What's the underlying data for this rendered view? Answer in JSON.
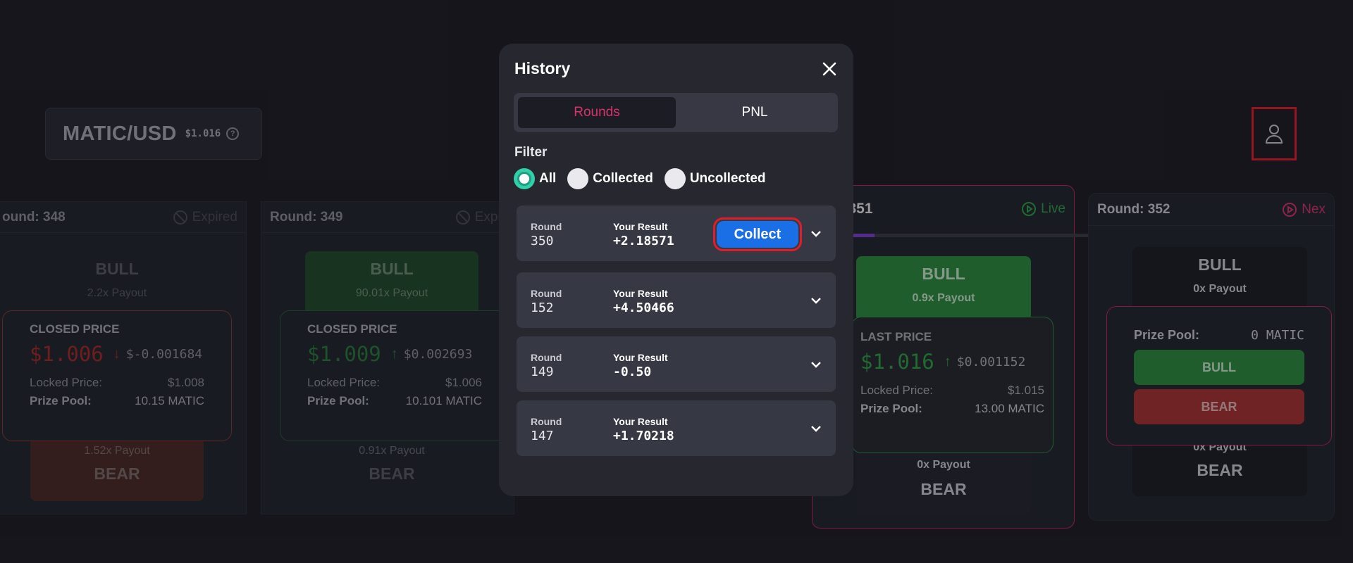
{
  "market": {
    "pair": "MATIC/USD",
    "price": "$1.016",
    "help_icon": "question-circle-icon"
  },
  "user_icon": "user-icon",
  "rounds": [
    {
      "round_label": "ound: 348",
      "status": "Expired",
      "bull": {
        "label": "BULL",
        "payout": "2.2x Payout"
      },
      "panel": {
        "title": "CLOSED PRICE",
        "price": "$1.006",
        "delta": "$-0.001684",
        "locked_label": "Locked Price:",
        "locked_value": "$1.008",
        "pool_label": "Prize Pool:",
        "pool_value": "10.15 MATIC"
      },
      "bear": {
        "label": "BEAR",
        "payout": "1.52x Payout"
      }
    },
    {
      "round_label": "Round: 349",
      "status": "Expir",
      "bull": {
        "label": "BULL",
        "payout": "90.01x Payout"
      },
      "panel": {
        "title": "CLOSED PRICE",
        "price": "$1.009",
        "delta": "$0.002693",
        "locked_label": "Locked Price:",
        "locked_value": "$1.006",
        "pool_label": "Prize Pool:",
        "pool_value": "10.101 MATIC"
      },
      "bear": {
        "label": "BEAR",
        "payout": "0.91x Payout"
      }
    },
    {
      "round_label": "nd: 351",
      "status": "Live",
      "bull": {
        "label": "BULL",
        "payout": "0.9x Payout"
      },
      "panel": {
        "title": "LAST PRICE",
        "price": "$1.016",
        "delta": "$0.001152",
        "locked_label": "Locked Price:",
        "locked_value": "$1.015",
        "pool_label": "Prize Pool:",
        "pool_value": "13.00 MATIC"
      },
      "bear": {
        "label": "BEAR",
        "payout": "0x Payout"
      }
    },
    {
      "round_label": "Round: 352",
      "status": "Nex",
      "bull": {
        "label": "BULL",
        "payout": "0x Payout"
      },
      "panel": {
        "pool_label": "Prize Pool:",
        "pool_value": "0 MATIC",
        "bull_btn": "BULL",
        "bear_btn": "BEAR"
      },
      "bear": {
        "label": "BEAR",
        "payout": "0x Payout"
      }
    }
  ],
  "modal": {
    "title": "History",
    "close_icon": "close-icon",
    "tabs": [
      {
        "label": "Rounds",
        "active": true
      },
      {
        "label": "PNL",
        "active": false
      }
    ],
    "filter": {
      "label": "Filter",
      "options": [
        {
          "label": "All",
          "selected": true
        },
        {
          "label": "Collected",
          "selected": false
        },
        {
          "label": "Uncollected",
          "selected": false
        }
      ]
    },
    "rows": [
      {
        "round_label": "Round",
        "round": "350",
        "result_label": "Your Result",
        "result": "+2.18571",
        "collect": "Collect"
      },
      {
        "round_label": "Round",
        "round": "152",
        "result_label": "Your Result",
        "result": "+4.50466"
      },
      {
        "round_label": "Round",
        "round": "149",
        "result_label": "Your Result",
        "result": "-0.50"
      },
      {
        "round_label": "Round",
        "round": "147",
        "result_label": "Your Result",
        "result": "+1.70218"
      }
    ]
  },
  "colors": {
    "accent_pink": "#d6336c",
    "green": "#2f9e44",
    "red": "#c92a2a",
    "blue": "#1a6ee6",
    "teal": "#31d0aa"
  }
}
